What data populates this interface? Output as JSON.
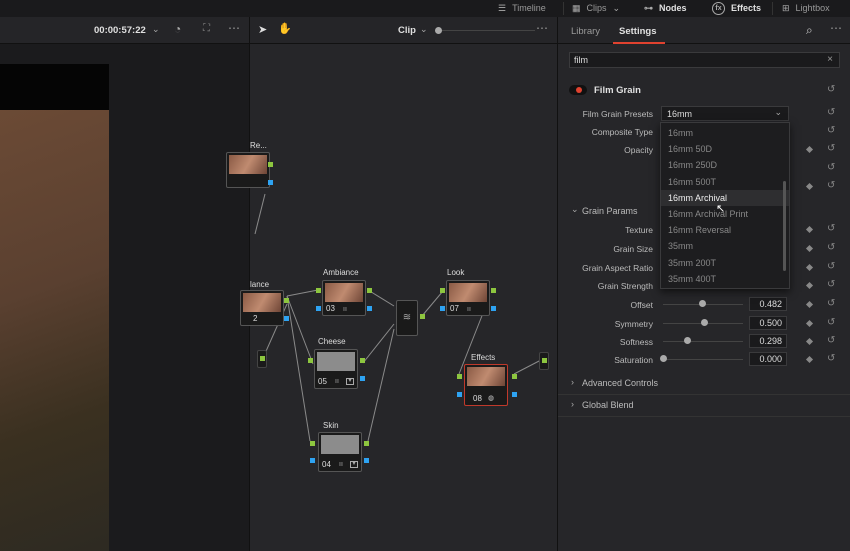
{
  "topbar": {
    "items": [
      {
        "label": "Timeline",
        "icon": "timeline-icon"
      },
      {
        "label": "Clips",
        "icon": "clips-icon"
      },
      {
        "label": "Nodes",
        "icon": "nodes-icon"
      },
      {
        "label": "Effects",
        "icon": "fx-icon"
      },
      {
        "label": "Lightbox",
        "icon": "lightbox-icon"
      }
    ]
  },
  "viewer": {
    "timecode": "00:00:57:22"
  },
  "node_editor": {
    "mode_label": "Clip",
    "nodes": [
      {
        "label": "Re...",
        "num": ""
      },
      {
        "label": "lance",
        "num": "2"
      },
      {
        "label": "Ambiance",
        "num": "03"
      },
      {
        "label": "Cheese",
        "num": "05"
      },
      {
        "label": "Skin",
        "num": "04"
      },
      {
        "label": "Look",
        "num": "07"
      },
      {
        "label": "Effects",
        "num": "08"
      }
    ]
  },
  "panel": {
    "tabs": [
      {
        "label": "Library"
      },
      {
        "label": "Settings"
      }
    ],
    "search_value": "film",
    "effect_title": "Film Grain",
    "preset_label": "Film Grain Presets",
    "preset_value": "16mm",
    "composite_label": "Composite Type",
    "opacity_label": "Opacity",
    "dropdown_options": [
      "16mm",
      "16mm 50D",
      "16mm 250D",
      "16mm 500T",
      "16mm Archival",
      "16mm Archival Print",
      "16mm Reversal",
      "35mm",
      "35mm 200T",
      "35mm 400T"
    ],
    "selected_option": "16mm Archival",
    "grain_params_label": "Grain Params",
    "params": [
      {
        "label": "Texture",
        "value": null
      },
      {
        "label": "Grain Size",
        "value": null
      },
      {
        "label": "Grain Aspect Ratio",
        "value": null
      },
      {
        "label": "Grain Strength",
        "value": null
      },
      {
        "label": "Offset",
        "value": "0.482"
      },
      {
        "label": "Symmetry",
        "value": "0.500"
      },
      {
        "label": "Softness",
        "value": "0.298"
      },
      {
        "label": "Saturation",
        "value": "0.000"
      }
    ],
    "advanced_label": "Advanced Controls",
    "global_label": "Global Blend"
  },
  "colors": {
    "accent": "#e0422f",
    "port_green": "#8dc63f",
    "port_blue": "#2ea3f2"
  }
}
